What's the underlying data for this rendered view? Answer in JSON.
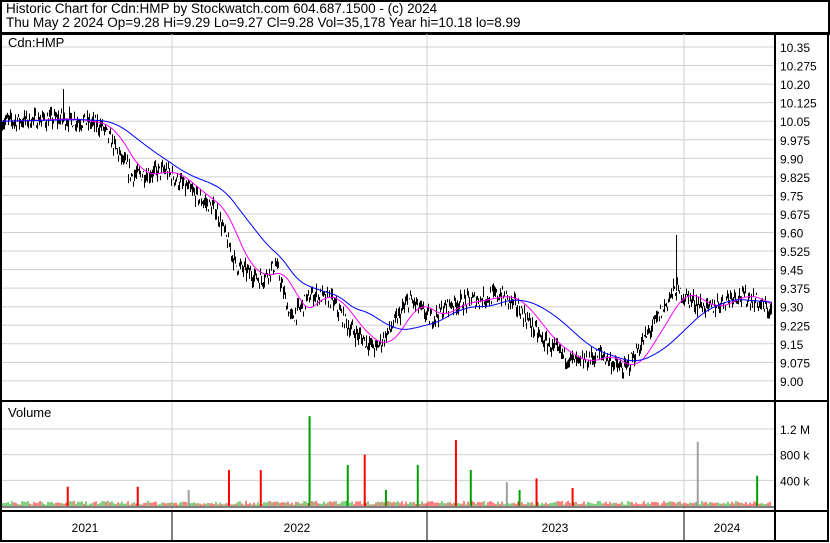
{
  "header": {
    "line1": "Historic Chart for Cdn:HMP by Stockwatch.com 604.687.1500 - (c) 2024",
    "line2": "Thu May  2 2024  Op=9.28  Hi=9.29  Lo=9.27  Cl=9.28  Vol=35,178  Year hi=10.18  lo=8.99"
  },
  "chart_data": {
    "type": "candlestick",
    "symbol": "Cdn:HMP",
    "volume_label": "Volume",
    "price_ticks": [
      "10.35",
      "10.275",
      "10.20",
      "10.125",
      "10.05",
      "9.975",
      "9.90",
      "9.825",
      "9.75",
      "9.675",
      "9.60",
      "9.525",
      "9.45",
      "9.375",
      "9.30",
      "9.225",
      "9.15",
      "9.075",
      "9.00"
    ],
    "ylim": [
      8.97,
      10.4
    ],
    "volume_ticks": [
      {
        "label": "1.2 M",
        "value": 1200000
      },
      {
        "label": "800 k",
        "value": 800000
      },
      {
        "label": "400 k",
        "value": 400000
      }
    ],
    "years": [
      "2021",
      "2022",
      "2023",
      "2024"
    ],
    "price_path": [
      [
        0,
        10.05
      ],
      [
        2.8,
        10.06
      ],
      [
        3.8,
        10.05
      ],
      [
        4.7,
        10.03
      ],
      [
        6.1,
        9.83
      ],
      [
        7.7,
        9.85
      ],
      [
        9.4,
        9.73
      ],
      [
        10.1,
        9.69
      ],
      [
        11,
        9.47
      ],
      [
        12.2,
        9.41
      ],
      [
        12.9,
        9.47
      ],
      [
        13.6,
        9.25
      ],
      [
        14.6,
        9.35
      ],
      [
        15.5,
        9.33
      ],
      [
        16.4,
        9.21
      ],
      [
        17.6,
        9.13
      ],
      [
        18.3,
        9.21
      ],
      [
        19.2,
        9.33
      ],
      [
        20.2,
        9.25
      ],
      [
        21.1,
        9.31
      ],
      [
        22.5,
        9.33
      ],
      [
        23.5,
        9.35
      ],
      [
        24.4,
        9.29
      ],
      [
        25.4,
        9.17
      ],
      [
        26.3,
        9.11
      ],
      [
        27.2,
        9.07
      ],
      [
        28.2,
        9.11
      ],
      [
        29.3,
        9.04
      ],
      [
        30,
        9.13
      ],
      [
        31,
        9.27
      ],
      [
        31.7,
        9.37
      ],
      [
        32.4,
        9.33
      ],
      [
        33.3,
        9.29
      ],
      [
        34.5,
        9.35
      ],
      [
        35.4,
        9.33
      ],
      [
        36.2,
        9.28
      ]
    ],
    "price_spikes": [
      [
        2.9,
        10.18
      ],
      [
        31.8,
        9.59
      ]
    ],
    "volume_spikes": [
      [
        3.1,
        300000,
        "red"
      ],
      [
        6.4,
        300000,
        "red"
      ],
      [
        8.8,
        250000,
        "grey"
      ],
      [
        10.7,
        560000,
        "red"
      ],
      [
        12.2,
        560000,
        "red"
      ],
      [
        14.5,
        1400000,
        "green"
      ],
      [
        16.3,
        640000,
        "green"
      ],
      [
        17.1,
        800000,
        "red"
      ],
      [
        18.1,
        250000,
        "green"
      ],
      [
        19.6,
        640000,
        "green"
      ],
      [
        21.4,
        1030000,
        "red"
      ],
      [
        22.1,
        560000,
        "green"
      ],
      [
        23.8,
        370000,
        "grey"
      ],
      [
        24.4,
        250000,
        "green"
      ],
      [
        25.2,
        430000,
        "red"
      ],
      [
        26.9,
        280000,
        "red"
      ],
      [
        32.8,
        1000000,
        "grey"
      ],
      [
        35.6,
        470000,
        "green"
      ]
    ],
    "moving_averages": [
      {
        "name": "short MA",
        "color": "#ff00ff"
      },
      {
        "name": "long MA",
        "color": "#0000ff"
      }
    ]
  }
}
